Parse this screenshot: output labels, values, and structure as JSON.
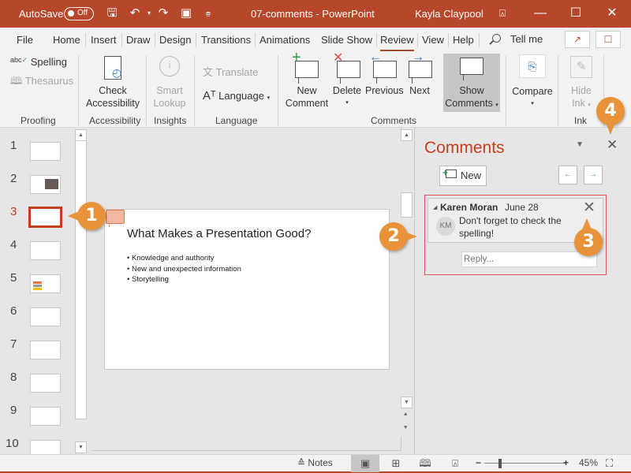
{
  "titlebar": {
    "autosave_label": "AutoSave",
    "autosave_state": "Off",
    "document_title": "07-comments  -  PowerPoint",
    "user_name": "Kayla Claypool"
  },
  "tabs": [
    {
      "label": "File"
    },
    {
      "label": "Home"
    },
    {
      "label": "Insert"
    },
    {
      "label": "Draw"
    },
    {
      "label": "Design"
    },
    {
      "label": "Transitions"
    },
    {
      "label": "Animations"
    },
    {
      "label": "Slide Show"
    },
    {
      "label": "Review",
      "active": true
    },
    {
      "label": "View"
    },
    {
      "label": "Help"
    }
  ],
  "tell_me": "Tell me",
  "ribbon": {
    "proofing": {
      "spelling": "Spelling",
      "thesaurus": "Thesaurus",
      "label": "Proofing"
    },
    "accessibility": {
      "check_line1": "Check",
      "check_line2": "Accessibility",
      "label": "Accessibility"
    },
    "insights": {
      "smart_line1": "Smart",
      "smart_line2": "Lookup",
      "label": "Insights"
    },
    "language": {
      "translate": "Translate",
      "language": "Language",
      "label": "Language"
    },
    "comments": {
      "new_line1": "New",
      "new_line2": "Comment",
      "delete": "Delete",
      "previous": "Previous",
      "next": "Next",
      "show_line1": "Show",
      "show_line2": "Comments",
      "label": "Comments"
    },
    "compare": {
      "label": "Compare"
    },
    "ink": {
      "hide_line1": "Hide",
      "hide_line2": "Ink",
      "label": "Ink"
    }
  },
  "thumbnails": [
    {
      "num": "1"
    },
    {
      "num": "2"
    },
    {
      "num": "3",
      "active": true
    },
    {
      "num": "4"
    },
    {
      "num": "5"
    },
    {
      "num": "6"
    },
    {
      "num": "7"
    },
    {
      "num": "8"
    },
    {
      "num": "9"
    },
    {
      "num": "10"
    }
  ],
  "slide": {
    "title": "What Makes a Presentation Good?",
    "bullets": [
      "Knowledge and authority",
      "New and unexpected information",
      "Storytelling"
    ]
  },
  "comments_pane": {
    "title": "Comments",
    "new_button": "New",
    "comment": {
      "author": "Karen Moran",
      "date": "June 28",
      "initials": "KM",
      "text": "Don't forget to check the spelling!",
      "reply_placeholder": "Reply..."
    }
  },
  "statusbar": {
    "notes": "Notes",
    "zoom_level": "45%",
    "zoom_fraction": 0.45
  },
  "callouts": [
    "1",
    "2",
    "3",
    "4"
  ],
  "colors": {
    "accent": "#b7472a",
    "callout": "#e8923a",
    "comment_outline": "#d9534f"
  }
}
